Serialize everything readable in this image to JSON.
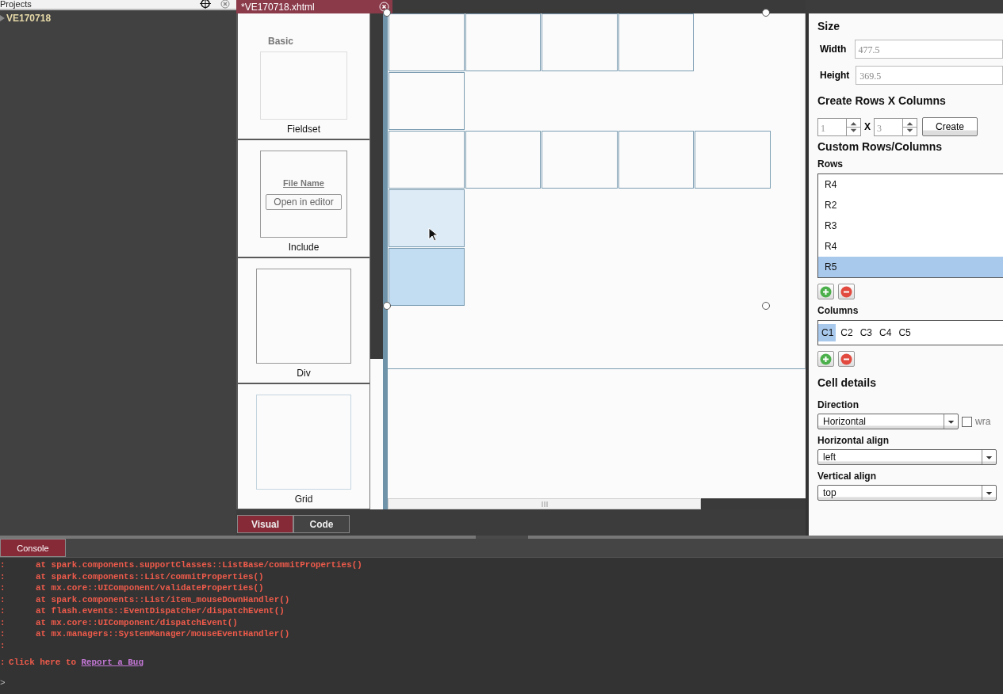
{
  "projects": {
    "title": "Projects",
    "tree": [
      {
        "label": "VE170718",
        "expanded": false
      }
    ]
  },
  "editor": {
    "tab": {
      "title": "*VE170718.xhtml",
      "selected": true
    },
    "palette": {
      "heading": "Basic",
      "items": [
        {
          "kind": "fieldset",
          "label": "Fieldset"
        },
        {
          "kind": "include",
          "label": "Include",
          "file_name": "File Name",
          "button": "Open in editor"
        },
        {
          "kind": "div",
          "label": "Div"
        },
        {
          "kind": "grid",
          "label": "Grid"
        }
      ]
    },
    "canvas": {
      "rows": [
        {
          "cells": [
            {
              "selected": false,
              "hovered": false
            },
            {
              "selected": false,
              "hovered": false
            },
            {
              "selected": false,
              "hovered": false
            },
            {
              "selected": false,
              "hovered": false
            }
          ]
        },
        {
          "cells": [
            {
              "selected": false,
              "hovered": false
            }
          ]
        },
        {
          "cells": [
            {
              "selected": false,
              "hovered": false
            },
            {
              "selected": false,
              "hovered": false
            },
            {
              "selected": false,
              "hovered": false
            },
            {
              "selected": false,
              "hovered": false
            },
            {
              "selected": false,
              "hovered": false
            }
          ]
        },
        {
          "cells": [
            {
              "selected": false,
              "hovered": true
            }
          ]
        },
        {
          "cells": [
            {
              "selected": true,
              "hovered": false
            }
          ]
        }
      ]
    },
    "view_tabs": [
      {
        "label": "Visual",
        "selected": true
      },
      {
        "label": "Code",
        "selected": false
      }
    ]
  },
  "properties": {
    "size": {
      "heading": "Size",
      "fields": [
        {
          "label": "Width",
          "value": "477.5"
        },
        {
          "label": "Height",
          "value": "369.5"
        }
      ]
    },
    "create": {
      "heading": "Create Rows X Columns",
      "rows_value": "1",
      "separator": "X",
      "columns_value": "3",
      "button": "Create"
    },
    "custom": {
      "heading": "Custom Rows/Columns",
      "rows_label": "Rows",
      "rows": [
        {
          "label": "R4",
          "selected": false
        },
        {
          "label": "R2",
          "selected": false
        },
        {
          "label": "R3",
          "selected": false
        },
        {
          "label": "R4",
          "selected": false
        },
        {
          "label": "R5",
          "selected": true
        }
      ],
      "columns_label": "Columns",
      "columns": [
        {
          "label": "C1",
          "selected": true
        },
        {
          "label": "C2",
          "selected": false
        },
        {
          "label": "C3",
          "selected": false
        },
        {
          "label": "C4",
          "selected": false
        },
        {
          "label": "C5",
          "selected": false
        }
      ]
    },
    "cell_details": {
      "heading": "Cell details",
      "direction": {
        "label": "Direction",
        "value": "Horizontal",
        "wrap_label": "wra",
        "wrap_checked": false
      },
      "horizontal_align": {
        "label": "Horizontal align",
        "value": "left"
      },
      "vertical_align": {
        "label": "Vertical align",
        "value": "top"
      }
    }
  },
  "console": {
    "tab": {
      "label": "Console",
      "selected": true
    },
    "lines": [
      {
        "kind": "trace",
        "prefix": ":",
        "text": "at spark.components.supportClasses::ListBase/commitProperties()"
      },
      {
        "kind": "trace",
        "prefix": ":",
        "text": "at spark.components::List/commitProperties()"
      },
      {
        "kind": "trace",
        "prefix": ":",
        "text": "at mx.core::UIComponent/validateProperties()"
      },
      {
        "kind": "trace",
        "prefix": ":",
        "text": "at spark.components::List/item_mouseDownHandler()"
      },
      {
        "kind": "trace",
        "prefix": ":",
        "text": "at flash.events::EventDispatcher/dispatchEvent()"
      },
      {
        "kind": "trace",
        "prefix": ":",
        "text": "at mx.core::UIComponent/dispatchEvent()"
      },
      {
        "kind": "trace",
        "prefix": ":",
        "text": "at mx.managers::SystemManager/mouseEventHandler()"
      },
      {
        "kind": "blank",
        "prefix": ":"
      },
      {
        "kind": "link",
        "prefix": ":",
        "text": "Click here to",
        "link": "Report a Bug"
      }
    ],
    "prompt": ">"
  }
}
